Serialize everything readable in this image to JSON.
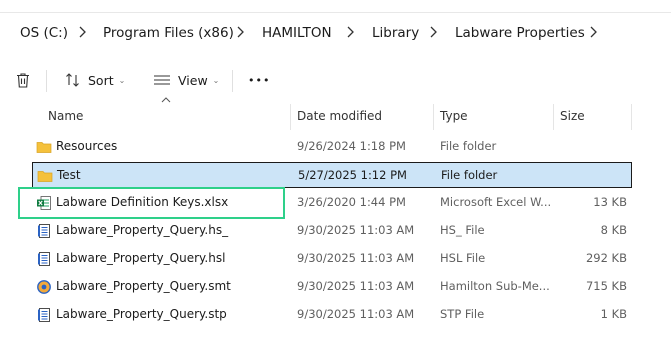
{
  "breadcrumb": {
    "items": [
      "OS (C:)",
      "Program Files (x86)",
      "HAMILTON",
      "Library",
      "Labware Properties"
    ]
  },
  "toolbar": {
    "sort_label": "Sort",
    "view_label": "View",
    "more_label": "•••",
    "delete_icon": "trash-icon",
    "sort_icon": "sort-arrows-icon",
    "view_icon": "list-view-icon"
  },
  "columns": {
    "name": "Name",
    "date": "Date modified",
    "type": "Type",
    "size": "Size"
  },
  "files": [
    {
      "name": "Resources",
      "date": "9/26/2024 1:18 PM",
      "type": "File folder",
      "size": "",
      "icon": "folder-icon",
      "selected": false
    },
    {
      "name": "Test",
      "date": "5/27/2025 1:12 PM",
      "type": "File folder",
      "size": "",
      "icon": "folder-icon",
      "selected": true
    },
    {
      "name": "Labware Definition Keys.xlsx",
      "date": "3/26/2020 1:44 PM",
      "type": "Microsoft Excel W...",
      "size": "13 KB",
      "icon": "excel-file-icon",
      "selected": false
    },
    {
      "name": "Labware_Property_Query.hs_",
      "date": "9/30/2025 11:03 AM",
      "type": "HS_ File",
      "size": "8 KB",
      "icon": "document-icon",
      "selected": false
    },
    {
      "name": "Labware_Property_Query.hsl",
      "date": "9/30/2025 11:03 AM",
      "type": "HSL File",
      "size": "292 KB",
      "icon": "document-icon",
      "selected": false
    },
    {
      "name": "Labware_Property_Query.smt",
      "date": "9/30/2025 11:03 AM",
      "type": "Hamilton Sub-Me...",
      "size": "715 KB",
      "icon": "hamilton-submethod-icon",
      "selected": false
    },
    {
      "name": "Labware_Property_Query.stp",
      "date": "9/30/2025 11:03 AM",
      "type": "STP File",
      "size": "1 KB",
      "icon": "document-icon",
      "selected": false
    }
  ],
  "colors": {
    "selection": "#cce4f7",
    "highlight": "#2ed08a",
    "folder": "#f5c13b"
  }
}
